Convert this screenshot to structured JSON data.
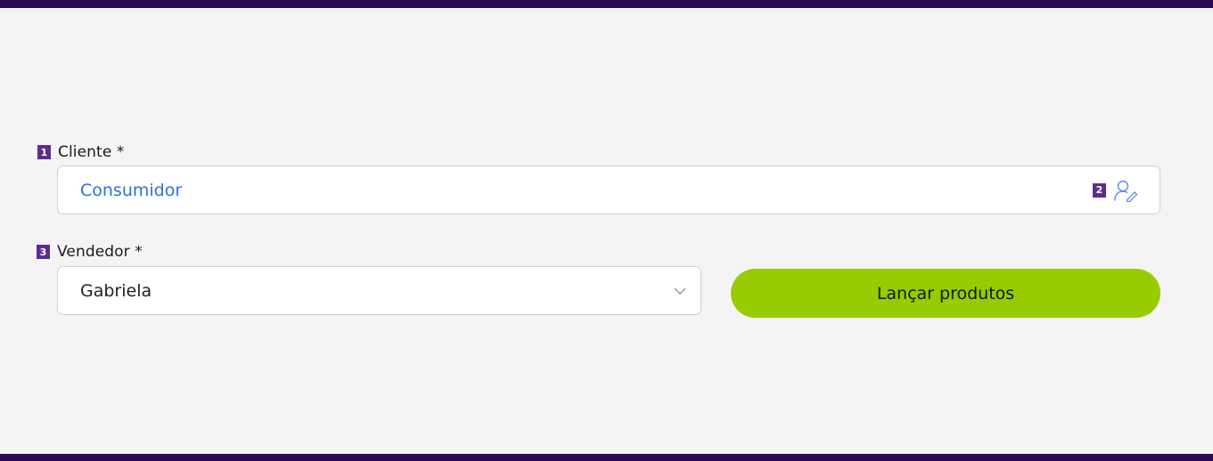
{
  "form": {
    "client": {
      "badge": "1",
      "label": "Cliente *",
      "value": "Consumidor",
      "icon_badge": "2",
      "icon": "user-edit-icon"
    },
    "seller": {
      "badge": "3",
      "label": "Vendedor *",
      "value": "Gabriela",
      "icon": "chevron-down-icon"
    },
    "launch_button_label": "Lançar produtos"
  },
  "colors": {
    "header_bar": "#2a0a52",
    "badge": "#5c2d91",
    "client_value": "#2f6fe0",
    "primary_button": "#96cc00",
    "background": "#f4f4f4"
  }
}
